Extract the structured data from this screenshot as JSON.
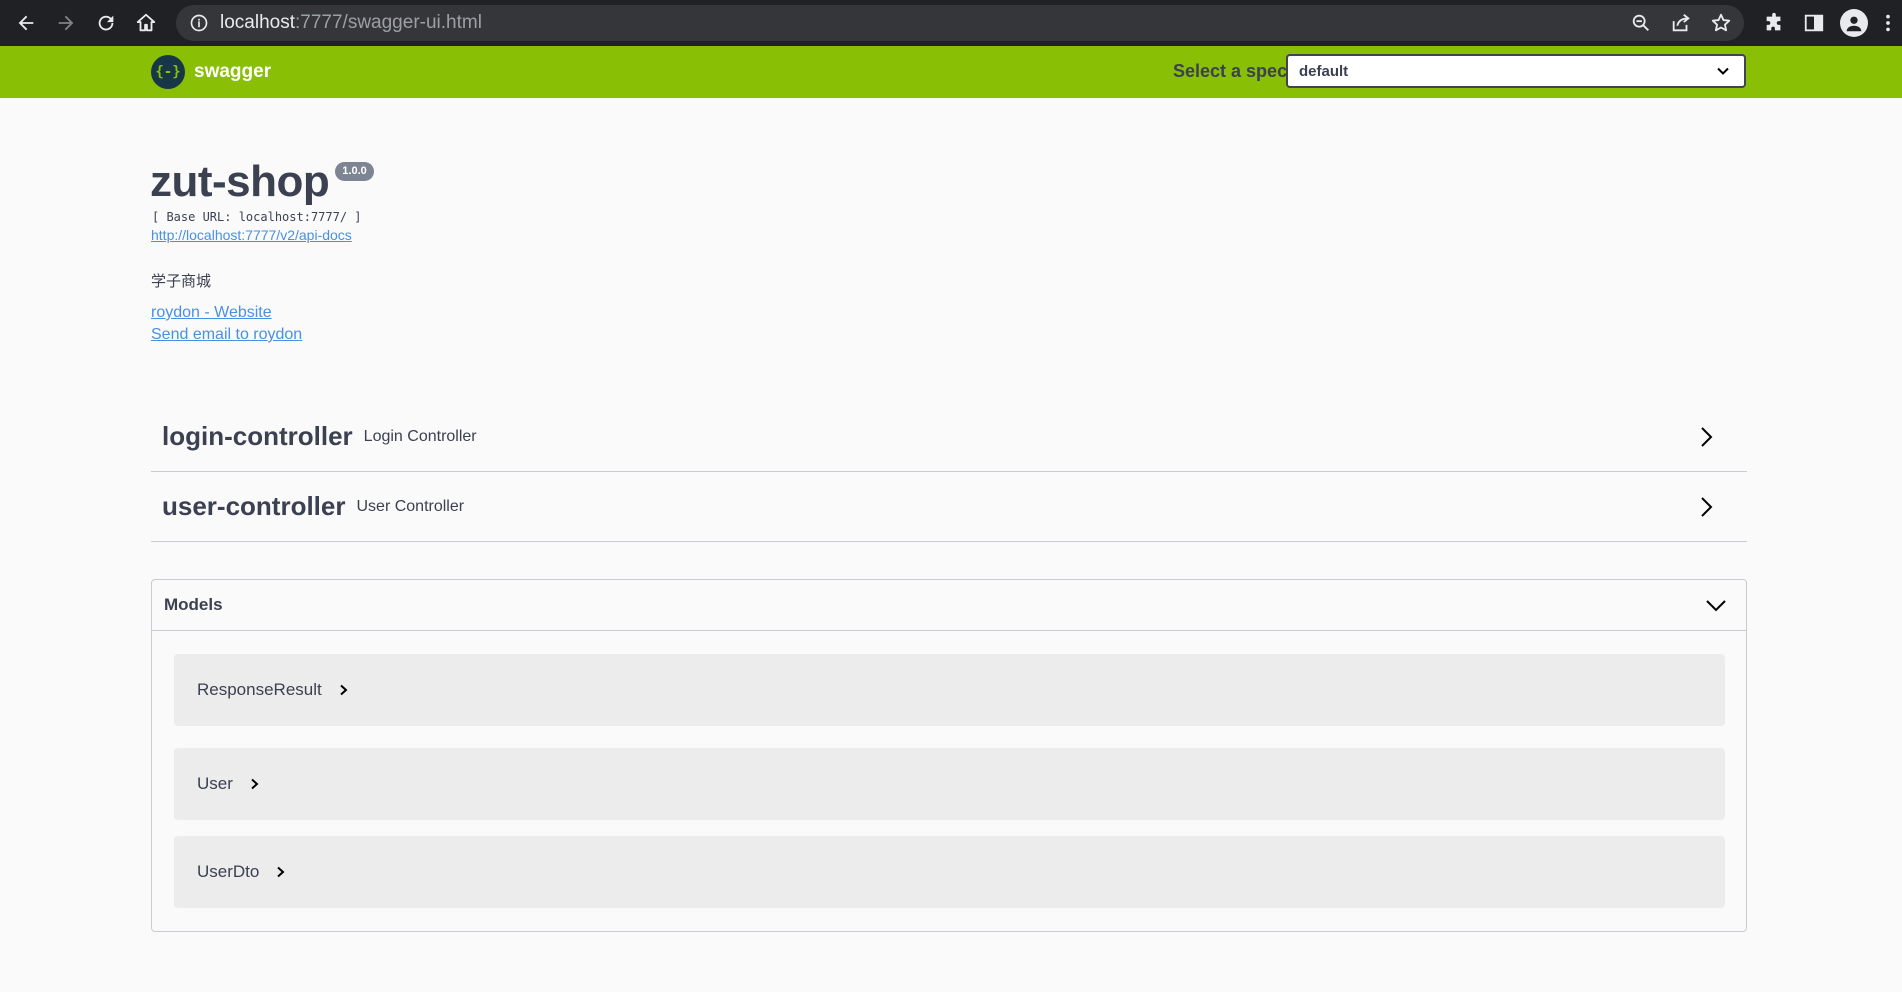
{
  "browser": {
    "url_host": "localhost",
    "url_path": ":7777/swagger-ui.html"
  },
  "topbar": {
    "logo_symbol": "{-}",
    "logo_text": "swagger",
    "spec_label": "Select a spec",
    "spec_value": "default"
  },
  "info": {
    "title": "zut-shop",
    "version": "1.0.0",
    "base_url": "[ Base URL: localhost:7777/ ]",
    "docs_link": "http://localhost:7777/v2/api-docs",
    "description": "学子商城",
    "website_link": "roydon - Website",
    "email_link": "Send email to roydon"
  },
  "tags": [
    {
      "name": "login-controller",
      "description": "Login Controller"
    },
    {
      "name": "user-controller",
      "description": "User Controller"
    }
  ],
  "models": {
    "title": "Models",
    "items": [
      "ResponseResult",
      "User",
      "UserDto"
    ]
  },
  "colors": {
    "topbar": "#89bf04",
    "link": "#4990e2",
    "text": "#3b4151"
  }
}
